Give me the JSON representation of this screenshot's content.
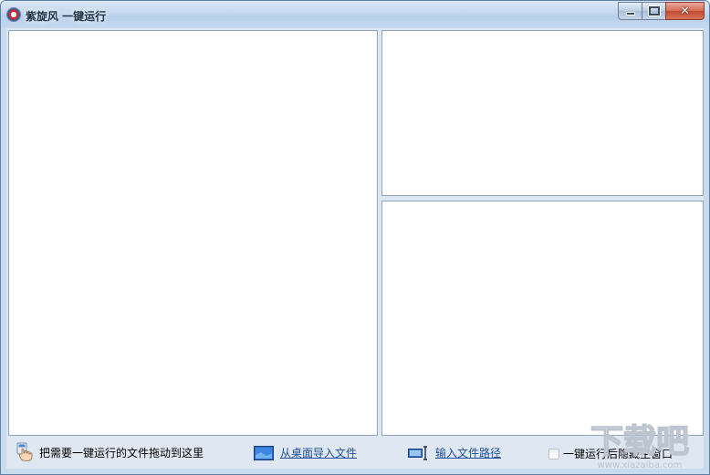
{
  "window": {
    "title": "紫旋风 一键运行",
    "close_glyph": "✕"
  },
  "bottombar": {
    "drag_hint": "把需要一键运行的文件拖动到这里",
    "import_desktop_label": "从桌面导入文件",
    "input_path_label": "输入文件路径",
    "hide_after_run_label": "一键运行后隐藏主窗口",
    "hide_after_run_checked": false
  },
  "icons": {
    "app": "app-icon",
    "hand": "hand-drag-icon",
    "desktop": "desktop-icon",
    "path": "text-cursor-icon"
  },
  "watermark": {
    "brand": "下载吧",
    "url": "www.xiazaiba.com"
  },
  "colors": {
    "link": "#1d4f9a",
    "frame": "#c9dcee",
    "close_button": "#c24a32"
  }
}
